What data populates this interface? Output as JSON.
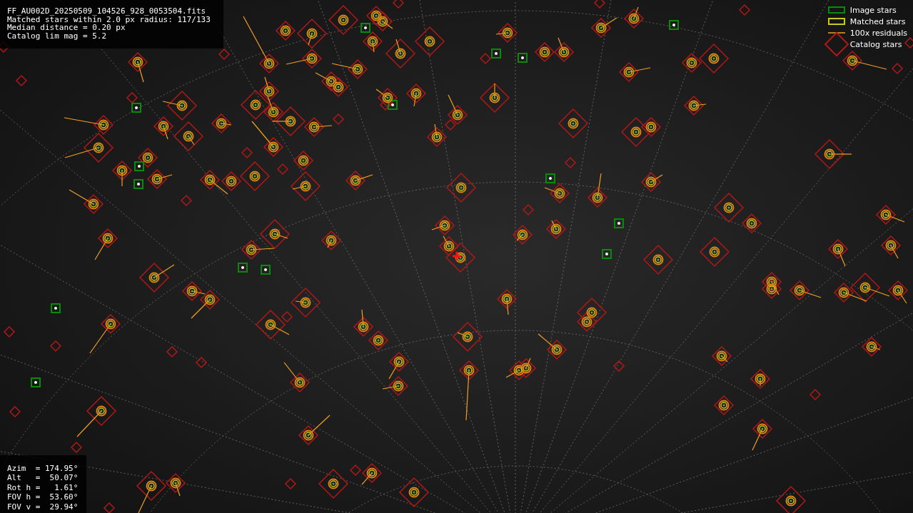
{
  "header_info": {
    "lines": [
      "FF_AU002D_20250509_104526_928_0053504.fits",
      "Matched stars within 2.0 px radius: 117/133",
      "Median distance = 0.20 px",
      "Catalog lim mag = 5.2"
    ]
  },
  "legend": [
    {
      "kind": "image",
      "label": "Image stars"
    },
    {
      "kind": "matched",
      "label": "Matched stars"
    },
    {
      "kind": "residual",
      "label": "100x residuals"
    },
    {
      "kind": "catalog",
      "label": "Catalog stars"
    }
  ],
  "pointing_info": {
    "lines": [
      "Azim  = 174.95°",
      "Alt   =  50.07°",
      "Rot h =   1.61°",
      "FOV h =  53.60°",
      "FOV v =  29.94°"
    ]
  }
}
